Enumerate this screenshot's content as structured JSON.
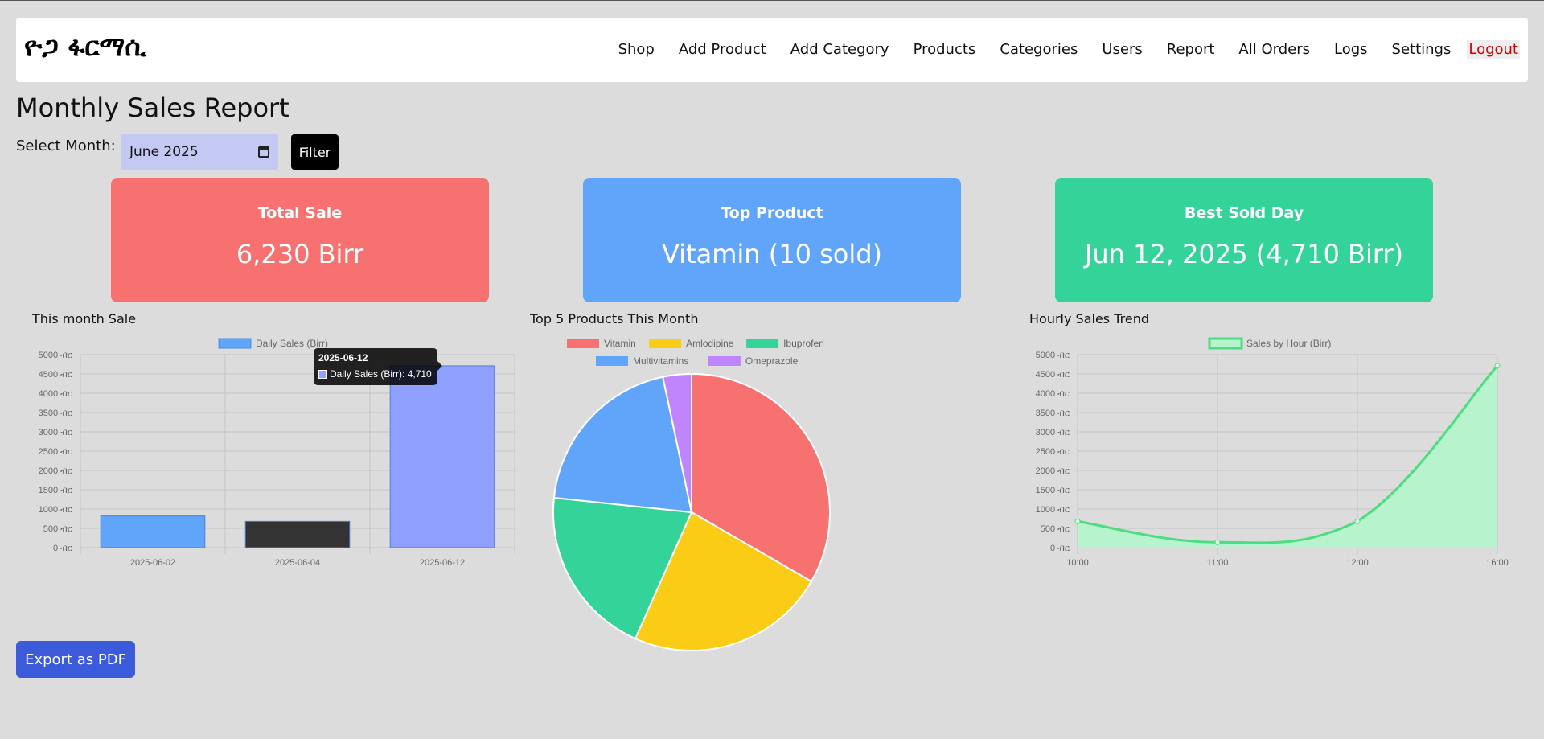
{
  "brand": "ዮጋ ፋርማሲ",
  "nav": {
    "links": [
      "Shop",
      "Add Product",
      "Add Category",
      "Products",
      "Categories",
      "Users",
      "Report",
      "All Orders",
      "Logs",
      "Settings"
    ],
    "logout": "Logout"
  },
  "page_title": "Monthly Sales Report",
  "filter": {
    "label": "Select Month:",
    "month_value": "June 2025",
    "button": "Filter"
  },
  "cards": [
    {
      "title": "Total Sale",
      "value": "6,230 Birr",
      "color": "#f87171"
    },
    {
      "title": "Top Product",
      "value": "Vitamin (10 sold)",
      "color": "#60a5fa"
    },
    {
      "title": "Best Sold Day",
      "value": "Jun 12, 2025 (4,710 Birr)",
      "color": "#34d399"
    }
  ],
  "export_button": "Export as PDF",
  "tooltip": {
    "title": "2025-06-12",
    "body": "Daily Sales (Birr): 4,710"
  },
  "chart_data": [
    {
      "type": "bar",
      "title": "This month Sale",
      "series": [
        {
          "name": "Daily Sales (Birr)",
          "values": [
            820,
            680,
            4710
          ]
        }
      ],
      "categories": [
        "2025-06-02",
        "2025-06-04",
        "2025-06-12"
      ],
      "bar_colors": [
        "#60a5fa",
        "#333333",
        "#8fa0ff"
      ],
      "ylim": [
        0,
        5000
      ],
      "yticks": [
        "0 ብር",
        "500 ብር",
        "1000 ብር",
        "1500 ብር",
        "2000 ብር",
        "2500 ብር",
        "3000 ብር",
        "3500 ብር",
        "4000 ብር",
        "4500 ብር",
        "5000 ብር"
      ],
      "legend": "top"
    },
    {
      "type": "pie",
      "title": "Top 5 Products This Month",
      "labels": [
        "Vitamin",
        "Amlodipine",
        "Ibuprofen",
        "Multivitamins",
        "Omeprazole"
      ],
      "values": [
        10,
        7,
        6,
        6,
        1
      ],
      "colors": [
        "#f87171",
        "#facc15",
        "#34d399",
        "#60a5fa",
        "#c084fc"
      ],
      "legend": "top"
    },
    {
      "type": "area",
      "title": "Hourly Sales Trend",
      "series": [
        {
          "name": "Sales by Hour (Birr)",
          "values": [
            680,
            140,
            680,
            4710
          ]
        }
      ],
      "categories": [
        "10:00",
        "11:00",
        "12:00",
        "16:00"
      ],
      "color": "#4ade80",
      "ylim": [
        0,
        5000
      ],
      "yticks": [
        "0 ብር",
        "500 ብር",
        "1000 ብር",
        "1500 ብር",
        "2000 ብር",
        "2500 ብር",
        "3000 ብር",
        "3500 ብር",
        "4000 ብር",
        "4500 ብር",
        "5000 ብር"
      ],
      "legend": "top"
    }
  ]
}
